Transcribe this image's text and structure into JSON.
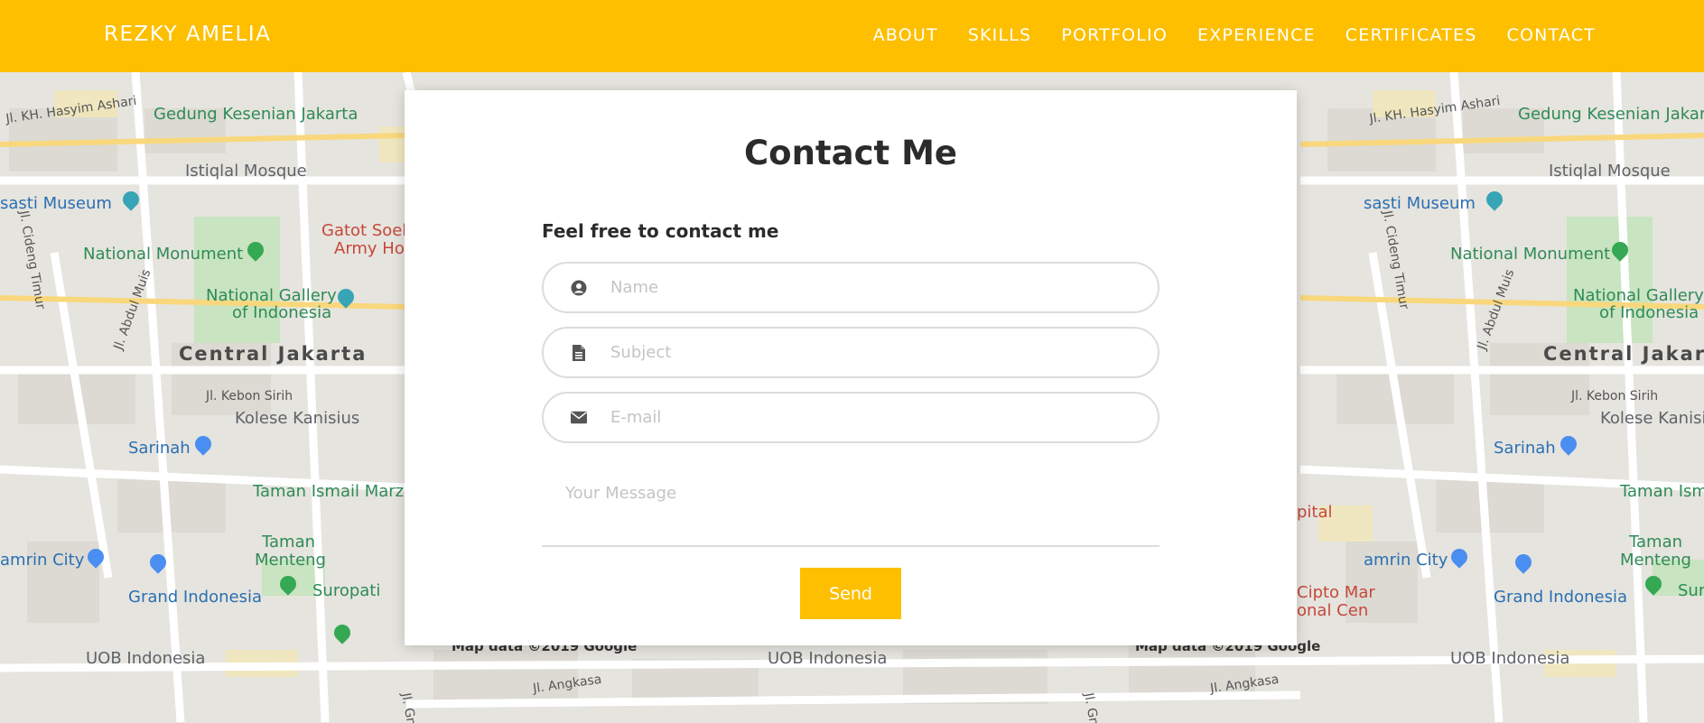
{
  "brand": "REZKY AMELIA",
  "nav": {
    "items": [
      {
        "label": "ABOUT"
      },
      {
        "label": "SKILLS"
      },
      {
        "label": "PORTFOLIO"
      },
      {
        "label": "EXPERIENCE"
      },
      {
        "label": "CERTIFICATES"
      },
      {
        "label": "CONTACT"
      }
    ]
  },
  "contact": {
    "title": "Contact Me",
    "intro": "Feel free to contact me",
    "name_placeholder": "Name",
    "subject_placeholder": "Subject",
    "email_placeholder": "E-mail",
    "message_placeholder": "Your Message",
    "send_label": "Send",
    "icons": {
      "name": "user-circle-icon",
      "subject": "document-icon",
      "email": "envelope-icon"
    }
  },
  "map": {
    "labels": {
      "hasyim": "Jl. KH. Hasyim Ashari",
      "gedung": "Gedung Kesenian Jakarta",
      "istiqlal": "Istiqlal Mosque",
      "museum": "sasti Museum",
      "gatot": "Gatot Soeb",
      "army": "Army Hos",
      "cideng": "Jl. Cideng Timur",
      "abdul": "Jl. Abdul Muis",
      "monument": "National Monument",
      "gallery1": "National Gallery",
      "gallery2": "of Indonesia",
      "central": "Central Jakarta",
      "central_cut": "Central Jakar",
      "kebon": "Jl. Kebon Sirih",
      "kanisius": "Kolese Kanisius",
      "sarinah": "Sarinah",
      "tim": "Taman Ismail Marzu",
      "tim_short": "Taman Isma",
      "pital": "pital",
      "taman": "Taman",
      "menteng": "Menteng",
      "suropati": "Suropati",
      "sur_cut": "Sur",
      "amrin": "amrin City",
      "grand": "Grand Indonesia",
      "cipto": "Cipto Mar",
      "onal": "onal Cen",
      "uob": "UOB Indonesia",
      "angkasa": "Jl. Angkasa",
      "gn": "Jl. Gn.",
      "credit": "Map data ©2019 Google"
    },
    "colors": {
      "road": "#ffffff",
      "block": "#e4e2dc",
      "park": "#c8e6c9",
      "water": "#aadaff"
    }
  },
  "colors": {
    "accent": "#fdbf00",
    "text": "#2b2b2b"
  }
}
